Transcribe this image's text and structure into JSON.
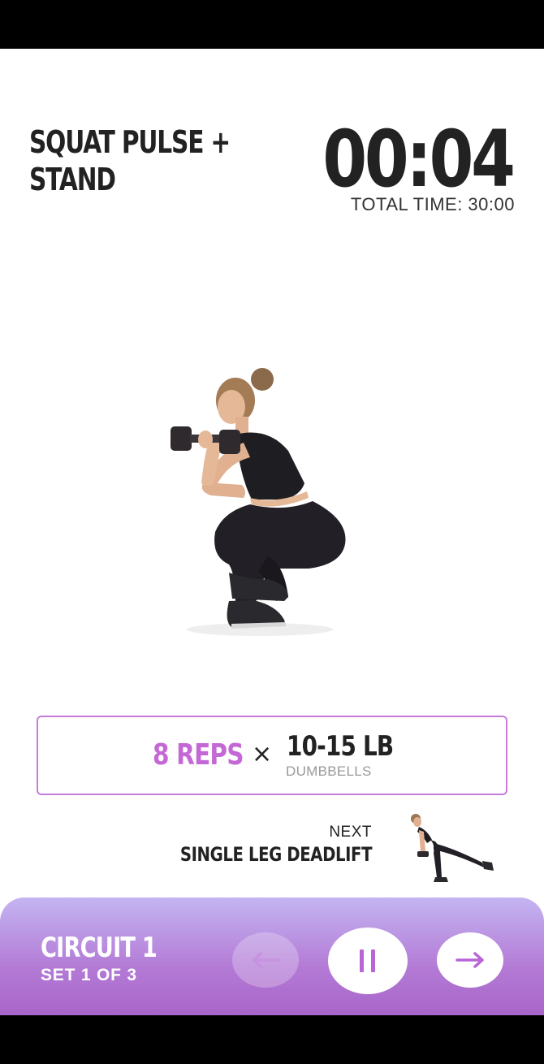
{
  "exercise": {
    "title_line1": "SQUAT PULSE +",
    "title_line2": "STAND",
    "timer": "00:04",
    "total_time": "TOTAL TIME: 30:00"
  },
  "reps": {
    "count": "8 REPS",
    "times": "×",
    "weight": "10-15 LB",
    "equipment": "DUMBBELLS"
  },
  "next": {
    "label": "NEXT",
    "name": "SINGLE LEG DEADLIFT"
  },
  "footer": {
    "circuit": "CIRCUIT 1",
    "set": "SET 1 OF 3"
  },
  "colors": {
    "accent": "#c468d6",
    "bar_top": "#c4b5f2",
    "bar_bottom": "#a965c9"
  },
  "icons": {
    "prev": "arrow-left-icon",
    "pause": "pause-icon",
    "next": "arrow-right-icon"
  }
}
